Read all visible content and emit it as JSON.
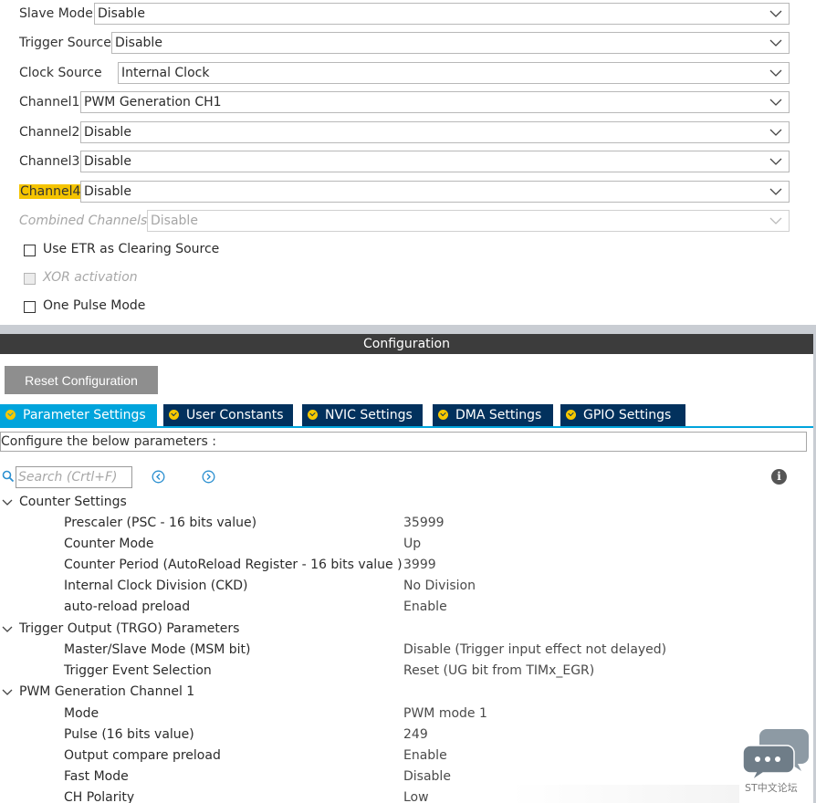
{
  "mode": {
    "rows": [
      {
        "label": "Slave Mode",
        "value": "Disable"
      },
      {
        "label": "Trigger Source",
        "value": "Disable"
      },
      {
        "label": "Clock Source",
        "value": "Internal Clock"
      },
      {
        "label": "Channel1",
        "value": "PWM Generation CH1"
      },
      {
        "label": "Channel2",
        "value": "Disable"
      },
      {
        "label": "Channel3",
        "value": "Disable"
      },
      {
        "label": "Channel4",
        "value": "Disable"
      },
      {
        "label": "Combined Channels",
        "value": "Disable"
      }
    ],
    "checkboxes": [
      {
        "label": "Use ETR as Clearing Source",
        "checked": false,
        "disabled": false
      },
      {
        "label": "XOR activation",
        "checked": false,
        "disabled": true
      },
      {
        "label": "One Pulse Mode",
        "checked": false,
        "disabled": false
      }
    ]
  },
  "configuration": {
    "header": "Configuration",
    "reset_label": "Reset Configuration",
    "tabs": [
      {
        "label": "Parameter Settings",
        "active": true
      },
      {
        "label": "User Constants",
        "active": false
      },
      {
        "label": "NVIC Settings",
        "active": false
      },
      {
        "label": "DMA Settings",
        "active": false
      },
      {
        "label": "GPIO Settings",
        "active": false
      }
    ],
    "description": "Configure the below parameters :",
    "search": {
      "placeholder": "Search (Crtl+F)"
    },
    "groups": [
      {
        "label": "Counter Settings",
        "params": [
          {
            "name": "Prescaler (PSC - 16 bits value)",
            "value": "35999"
          },
          {
            "name": "Counter Mode",
            "value": "Up"
          },
          {
            "name": "Counter Period (AutoReload Register - 16 bits value )",
            "value": "3999"
          },
          {
            "name": "Internal Clock Division (CKD)",
            "value": "No Division"
          },
          {
            "name": "auto-reload preload",
            "value": "Enable"
          }
        ]
      },
      {
        "label": "Trigger Output (TRGO) Parameters",
        "params": [
          {
            "name": "Master/Slave Mode (MSM bit)",
            "value": "Disable (Trigger input effect not delayed)"
          },
          {
            "name": "Trigger Event Selection",
            "value": "Reset (UG bit from TIMx_EGR)"
          }
        ]
      },
      {
        "label": "PWM Generation Channel 1",
        "params": [
          {
            "name": "Mode",
            "value": "PWM mode 1"
          },
          {
            "name": "Pulse (16 bits value)",
            "value": "249"
          },
          {
            "name": "Output compare preload",
            "value": "Enable"
          },
          {
            "name": "Fast Mode",
            "value": "Disable"
          },
          {
            "name": "CH Polarity",
            "value": "Low"
          }
        ]
      }
    ]
  },
  "chat_widget": {
    "label": "ST中文论坛"
  },
  "colors": {
    "tab_active": "#00a4dc",
    "tab_inactive": "#02315d",
    "highlight": "#f5c400",
    "header_bg": "#3c3c3c"
  }
}
